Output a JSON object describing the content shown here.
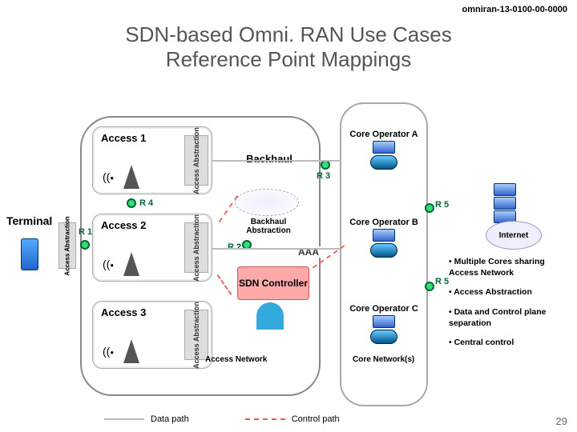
{
  "doc_id": "omniran-13-0100-00-0000",
  "title_line1": "SDN-based Omni. RAN Use Cases",
  "title_line2": "Reference Point Mappings",
  "page_number": "29",
  "terminal_label": "Terminal",
  "access_abstraction": "Access Abstraction",
  "access_panels": [
    "Access 1",
    "Access 2",
    "Access 3"
  ],
  "backhaul": "Backhaul",
  "backhaul_abstraction": "Backhaul Abstraction",
  "sdn_controller": "SDN Controller",
  "aaa": "AAA",
  "reference_points": {
    "r1": "R 1",
    "r2": "R 2",
    "r3": "R 3",
    "r4": "R 4",
    "r5": "R 5"
  },
  "core_operators": [
    "Core Operator A",
    "Core Operator B",
    "Core Operator C"
  ],
  "internet": "Internet",
  "access_network": "Access Network",
  "core_networks": "Core Network(s)",
  "bullets": [
    "Multiple Cores sharing Access Network",
    "Access Abstraction",
    "Data and Control plane separation",
    "Central control"
  ],
  "legend": {
    "data_path": "Data path",
    "control_path": "Control path"
  }
}
